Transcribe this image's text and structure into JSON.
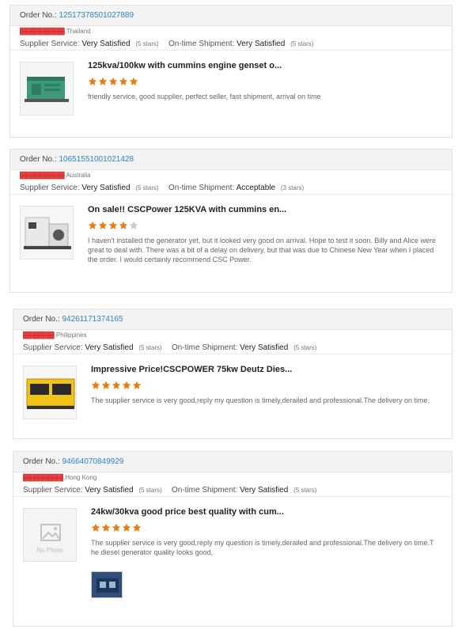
{
  "labels": {
    "order_no": "Order No.:",
    "supplier_service": "Supplier Service:",
    "ontime_shipment": "On-time Shipment:",
    "no_photo": "No Photo"
  },
  "colors": {
    "star_on": "#f07b0d",
    "star_off": "#cccccc",
    "link": "#2a86c8"
  },
  "reviews": [
    {
      "order_no": "12517378501027889",
      "buyer_name": "██████████",
      "buyer_country": ",Thailand",
      "supplier_service": "Very Satisfied",
      "supplier_stars": "(5 stars)",
      "shipment": "Very Satisfied",
      "shipment_stars": "(5 stars)",
      "product_title": "125kva/100kw with cummins engine genset o...",
      "rating": 5,
      "review_text": "friendly service, good supplier, perfect seller, fast shipment, arrival on time",
      "image": "green-generator-icon"
    },
    {
      "order_no": "10651551001021428",
      "buyer_name": "██████████",
      "buyer_country": " Australia",
      "supplier_service": "Very Satisfied",
      "supplier_stars": "(5 stars)",
      "shipment": "Acceptable",
      "shipment_stars": "(3 stars)",
      "product_title": "On sale!! CSCPower 125KVA with cummins en...",
      "rating": 4,
      "review_text": "I haven't installed the generator yet, but it looked very good on arrival. Hope to test it soon. Billy and Alice were great to deal with. There was a bit of a delay on delivery, but that was due to Chinese New Year when I placed the order. I would certainly recommend CSC Power.",
      "image": "white-generator-icon"
    },
    {
      "order_no": "94261171374165",
      "buyer_name": "███████",
      "buyer_country": " Philippines",
      "supplier_service": "Very Satisfied",
      "supplier_stars": "(5 stars)",
      "shipment": "Very Satisfied",
      "shipment_stars": "(5 stars)",
      "product_title": "Impressive Price!CSCPOWER 75kw Deutz Dies...",
      "rating": 5,
      "review_text": "The supplier service is very good,reply my question is timely,derailed and professional.The delivery on time.",
      "image": "yellow-generator-icon"
    },
    {
      "order_no": "94664070849929",
      "buyer_name": "█████████",
      "buyer_country": ",Hong Kong",
      "supplier_service": "Very Satisfied",
      "supplier_stars": "(5 stars)",
      "shipment": "Very Satisfied",
      "shipment_stars": "(5 stars)",
      "product_title": "24kw/30kva good price best quality with cum...",
      "rating": 5,
      "review_text": "The supplier service is very good,reply my question is timely,derailed and professional.The delivery on time.The diesel generator quality looks good,",
      "image": "no-photo-icon",
      "extra_image": "generator-photo-thumbnail"
    }
  ]
}
